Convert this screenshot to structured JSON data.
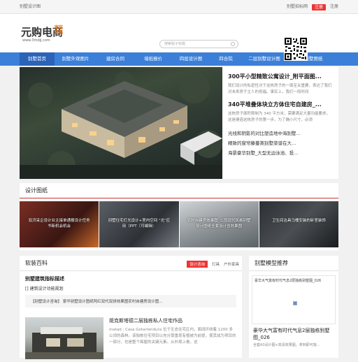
{
  "topbar": {
    "left": "别墅设计图",
    "links": [
      "别墅招标网",
      "注册",
      "注册"
    ]
  },
  "logo": {
    "main": "元购电商",
    "side": "家装攻略",
    "url": "www.3mdjj.com"
  },
  "search": {
    "placeholder": "搜索贴子标题"
  },
  "nav": {
    "items": [
      "别墅首页",
      "别墅外观图片",
      "建房合同",
      "墙纸报价",
      "四层设计图",
      "四合院",
      "二层别墅设计图",
      "三层别墅图纸"
    ]
  },
  "hero": {
    "news": [
      {
        "title": "300平小型精致公寓设计_附平面图...",
        "desc": "我们设计的私密性对于这栋房子的一面至关重要，表达了我们对未来房子主人的祝福。事实上，我们一段时间"
      },
      {
        "title": "340平堆叠体块立方体住宅自建房_...",
        "desc": "这栋房子面积限制为 340 平方米，需要满足大量功能要求，这是建造这栋房子的第一步。为了确小尺寸，必须"
      }
    ],
    "links": [
      "光线和阴影的对比塑造地中海别墅...",
      "精致的窗帘藤蔓蒸别墅菜谱在大...",
      "海景豪华别墅_大型无边泳池、投..."
    ]
  },
  "gallery": {
    "title": "设计图纸",
    "items": [
      "双浒采企设计业主接单通报设计任务书新机会机会",
      "别墅住宅灯光设计+室内空间 \"光\"应用（PPT（可编辑）",
      "农村自建房效果图_二层现代风格别墅设计图纸全套设计含效果图",
      "卫生间洁具马桶安装的卧室装饰"
    ]
  },
  "baike": {
    "title": "软装百科",
    "tabs": [
      "设计咨询",
      "灯具",
      "户外家具"
    ],
    "heading": "别墅建筑指标描述",
    "line": "建筑设计功能规划",
    "desc": "【别墅设计咨询】 豪华别墅设计图纸阿红双代双拼效果图农村自建房设计图...",
    "item": {
      "title": "姬克斯塔德二层独栋私人住宅作品",
      "desc": "matad : Casa Gotarrendura 位于生态住宅区内，面阔环绕着 1200 多公顷的森林。该独栋住宅项目以充分尊重现有植被为前提，使其成为项目的一部分，也是整个面屋的关键元素。从外观上看，这"
    }
  },
  "rec": {
    "title": "别墅模型推荐",
    "caption": "豪华大气富有时代气息2层独栋别墅图_026",
    "name": "豪华大气富有时代气息2层独栋别墅图_026",
    "desc": "全套A3设计图+高清效果图，拿到即可施..."
  }
}
